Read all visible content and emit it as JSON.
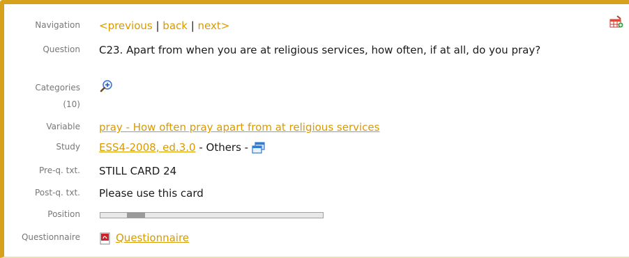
{
  "navigation": {
    "label": "Navigation",
    "previous": "<previous",
    "sep1": " | ",
    "back": "back",
    "sep2": " | ",
    "next": "next>"
  },
  "question": {
    "label": "Question",
    "text": "C23. Apart from when you are at religious services, how often, if at all, do you pray?"
  },
  "categories": {
    "label": "Categories",
    "count": "(10)",
    "icon": "zoom-in-icon"
  },
  "variable": {
    "label": "Variable",
    "link": "pray - How often pray apart from at religious services"
  },
  "study": {
    "label": "Study",
    "link": "ESS4-2008, ed.3.0",
    "suffix": " - Others - ",
    "icon": "windows-icon"
  },
  "pre_question": {
    "label": "Pre-q. txt.",
    "text": "STILL CARD 24"
  },
  "post_question": {
    "label": "Post-q. txt.",
    "text": "Please use this card"
  },
  "position": {
    "label": "Position",
    "start_fraction": 0.12,
    "end_fraction": 0.2
  },
  "questionnaire": {
    "label": "Questionnaire",
    "link": "Questionnaire",
    "icon": "pdf-icon"
  },
  "toolbar": {
    "add_to_table_icon": "add-to-table-icon"
  },
  "colors": {
    "accent": "#d6a21c",
    "link": "#d99a00",
    "label": "#777777"
  }
}
